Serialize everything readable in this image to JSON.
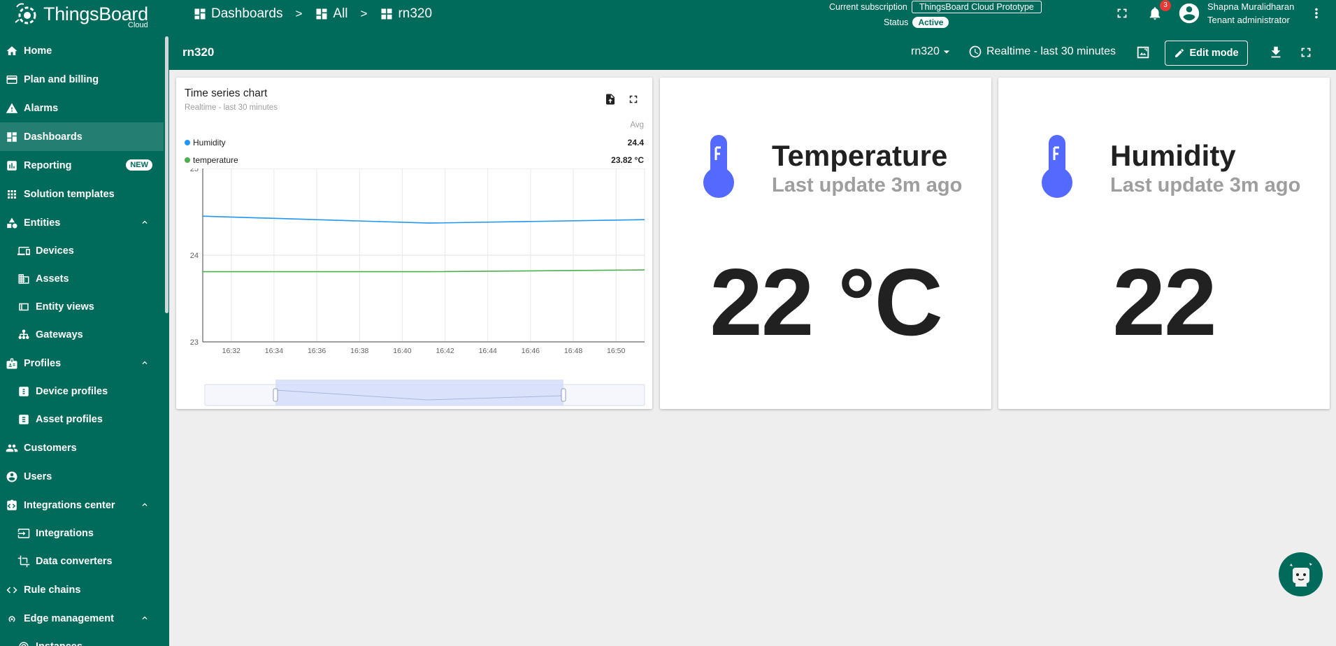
{
  "app": {
    "logo_text": "ThingsBoard",
    "logo_sub": "Cloud"
  },
  "sidebar": {
    "items": [
      {
        "label": "Home",
        "icon": "home-icon"
      },
      {
        "label": "Plan and billing",
        "icon": "billing-icon"
      },
      {
        "label": "Alarms",
        "icon": "alarm-icon"
      },
      {
        "label": "Dashboards",
        "icon": "dashboard-icon",
        "active": true
      },
      {
        "label": "Reporting",
        "icon": "reporting-icon",
        "badge": "NEW"
      },
      {
        "label": "Solution templates",
        "icon": "apps-icon"
      },
      {
        "label": "Entities",
        "icon": "entities-icon",
        "expanded": true
      },
      {
        "label": "Devices",
        "icon": "devices-icon",
        "sub": true
      },
      {
        "label": "Assets",
        "icon": "assets-icon",
        "sub": true
      },
      {
        "label": "Entity views",
        "icon": "entity-views-icon",
        "sub": true
      },
      {
        "label": "Gateways",
        "icon": "gateway-icon",
        "sub": true
      },
      {
        "label": "Profiles",
        "icon": "profiles-icon",
        "expanded": true
      },
      {
        "label": "Device profiles",
        "icon": "device-profile-icon",
        "sub": true
      },
      {
        "label": "Asset profiles",
        "icon": "asset-profile-icon",
        "sub": true
      },
      {
        "label": "Customers",
        "icon": "customers-icon"
      },
      {
        "label": "Users",
        "icon": "users-icon"
      },
      {
        "label": "Integrations center",
        "icon": "integrations-center-icon",
        "expanded": true
      },
      {
        "label": "Integrations",
        "icon": "integrations-icon",
        "sub": true
      },
      {
        "label": "Data converters",
        "icon": "data-converters-icon",
        "sub": true
      },
      {
        "label": "Rule chains",
        "icon": "rule-chains-icon"
      },
      {
        "label": "Edge management",
        "icon": "edge-icon",
        "expanded": true
      },
      {
        "label": "Instances",
        "icon": "instances-icon",
        "sub": true
      }
    ]
  },
  "breadcrumb": {
    "items": [
      "Dashboards",
      "All",
      "rn320"
    ],
    "separator": ">"
  },
  "subscription": {
    "label": "Current subscription",
    "plan": "ThingsBoard Cloud Prototype",
    "status_label": "Status",
    "status": "Active"
  },
  "notifications": {
    "count": "3"
  },
  "user": {
    "name": "Shapna Muralidharan",
    "role": "Tenant administrator"
  },
  "toolbar": {
    "dashboard_title": "rn320",
    "state": "rn320",
    "timewindow": "Realtime - last 30 minutes",
    "edit_label": "Edit mode"
  },
  "chart_widget": {
    "title": "Time series chart",
    "subtitle": "Realtime - last 30 minutes",
    "avg_header": "Avg",
    "legend": [
      {
        "name": "Humidity",
        "avg": "24.4",
        "color": "#2196f3"
      },
      {
        "name": "temperature",
        "avg": "23.82 °C",
        "color": "#4caf50"
      }
    ]
  },
  "chart_data": {
    "type": "line",
    "ylim": [
      23,
      25
    ],
    "y_ticks": [
      "25",
      "24",
      "23"
    ],
    "x_ticks": [
      "16:32",
      "16:34",
      "16:36",
      "16:38",
      "16:40",
      "16:42",
      "16:44",
      "16:46",
      "16:48",
      "16:50"
    ],
    "series": [
      {
        "name": "Humidity",
        "color": "#2196f3",
        "points": [
          [
            "16:30:40",
            24.45
          ],
          [
            "16:41:15",
            24.37
          ],
          [
            "16:51:20",
            24.41
          ]
        ]
      },
      {
        "name": "temperature",
        "color": "#4caf50",
        "points": [
          [
            "16:30:40",
            23.81
          ],
          [
            "16:41:15",
            23.81
          ],
          [
            "16:51:20",
            23.83
          ]
        ]
      }
    ],
    "grid": true,
    "legend": "top"
  },
  "temp_card": {
    "title": "Temperature",
    "subtitle": "Last update 3m ago",
    "value": "22 °C",
    "icon": "thermometer-icon",
    "icon_color": "#5469ff"
  },
  "humidity_card": {
    "title": "Humidity",
    "subtitle": "Last update 3m ago",
    "value": "22",
    "icon": "thermometer-icon",
    "icon_color": "#5469ff"
  },
  "colors": {
    "primary": "#006b5b",
    "background": "#eeeeee",
    "accent_blue": "#5469ff"
  }
}
